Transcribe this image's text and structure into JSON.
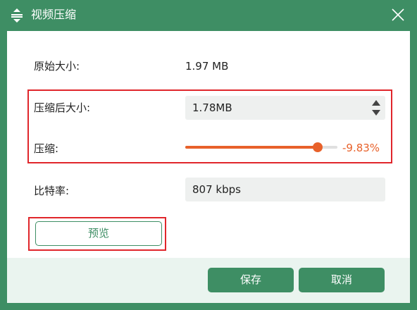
{
  "window": {
    "title": "视频压缩"
  },
  "fields": {
    "original_size": {
      "label": "原始大小:",
      "value": "1.97 MB"
    },
    "compressed_size": {
      "label": "压缩后大小:",
      "value": "1.78MB"
    },
    "compression": {
      "label": "压缩:",
      "percent_text": "-9.83%",
      "slider_fraction": 0.87
    },
    "bitrate": {
      "label": "比特率:",
      "value": "807 kbps"
    }
  },
  "buttons": {
    "preview": "预览",
    "save": "保存",
    "cancel": "取消"
  },
  "colors": {
    "primary": "#3e8e64",
    "accent": "#e8612a",
    "highlight": "#e0262b",
    "field_bg": "#eef0ef"
  },
  "icons": {
    "title": "compress-icon",
    "close": "close-icon",
    "spin_up": "caret-up-icon",
    "spin_down": "caret-down-icon"
  }
}
